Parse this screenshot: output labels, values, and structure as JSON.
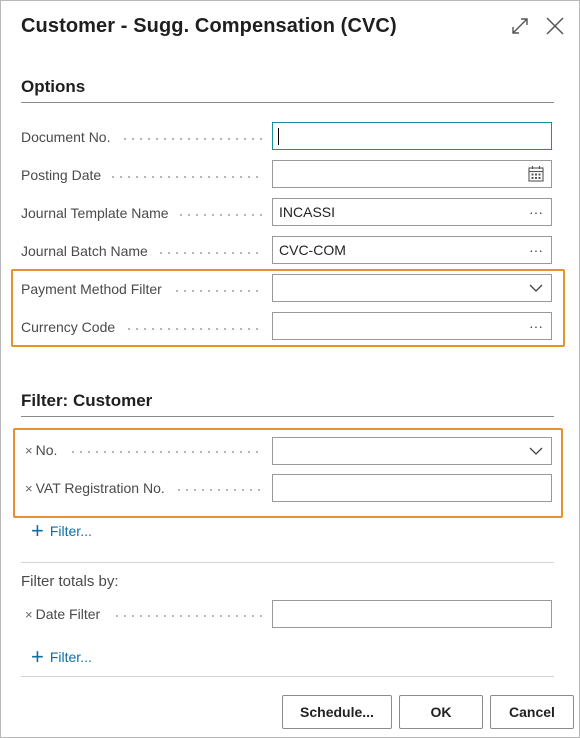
{
  "dialog": {
    "title": "Customer - Sugg. Compensation (CVC)"
  },
  "options": {
    "heading": "Options",
    "fields": [
      {
        "label": "Document No.",
        "value": ""
      },
      {
        "label": "Posting Date",
        "value": ""
      },
      {
        "label": "Journal Template Name",
        "value": "INCASSI"
      },
      {
        "label": "Journal Batch Name",
        "value": "CVC-COM"
      },
      {
        "label": "Payment Method Filter",
        "value": ""
      },
      {
        "label": "Currency Code",
        "value": ""
      }
    ]
  },
  "filter_customer": {
    "heading": "Filter: Customer",
    "fields": [
      {
        "label": "No.",
        "value": ""
      },
      {
        "label": "VAT Registration No.",
        "value": ""
      }
    ],
    "add_filter_label": "Filter..."
  },
  "filter_totals": {
    "heading": "Filter totals by:",
    "fields": [
      {
        "label": "Date Filter",
        "value": ""
      }
    ],
    "add_filter_label": "Filter..."
  },
  "remove_symbol": "×",
  "buttons": {
    "schedule": "Schedule...",
    "ok": "OK",
    "cancel": "Cancel"
  },
  "icons": {
    "expand": "expand-icon",
    "close": "close-icon",
    "calendar": "calendar-icon",
    "lookup": "ellipsis-icon",
    "dropdown": "chevron-down-icon",
    "add": "plus-icon"
  },
  "colors": {
    "highlight": "#e8912f",
    "focus_border": "#1a8f9c",
    "link": "#0e6fa8"
  }
}
